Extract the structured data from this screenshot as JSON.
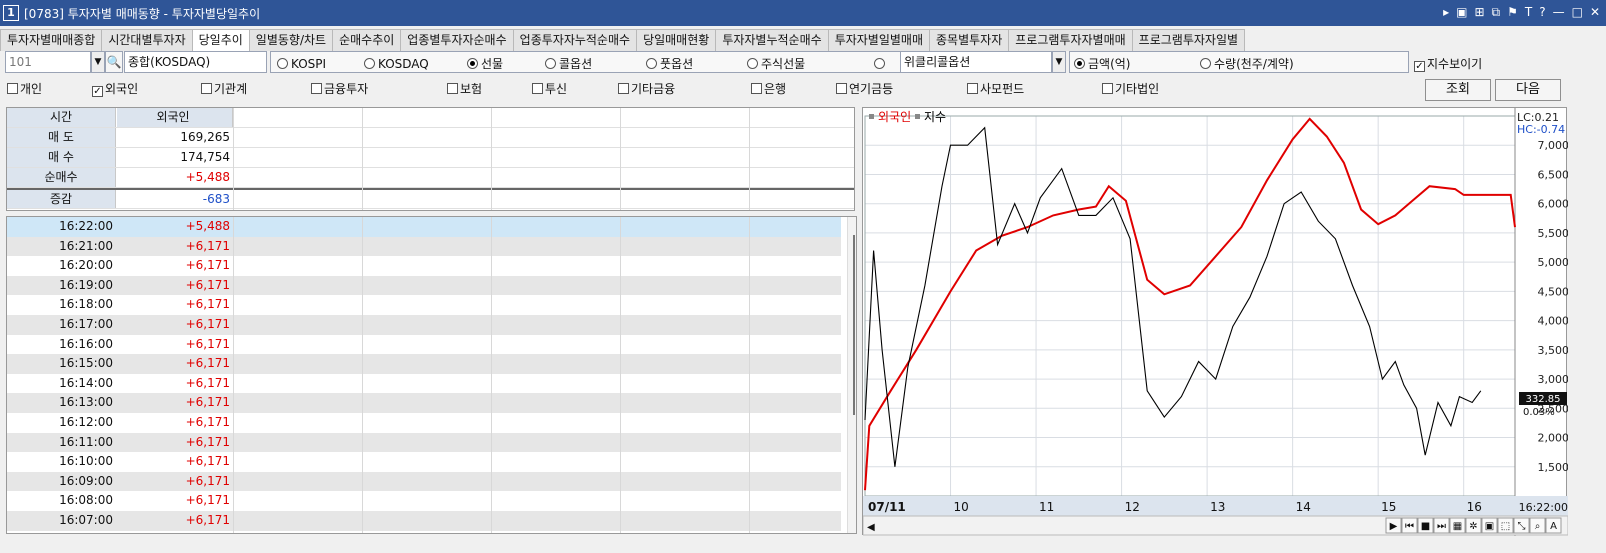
{
  "window": {
    "number": "1",
    "title": "[0783] 투자자별 매매동향 - 투자자별당일추이",
    "icons": [
      "menu-arrow-icon",
      "mdi-icon",
      "layout-icon",
      "restore-window-icon",
      "pin-icon",
      "font-icon",
      "help-icon",
      "minimize-icon",
      "maximize-icon",
      "close-icon"
    ]
  },
  "tabs": [
    "투자자별매매종합",
    "시간대별투자자",
    "당일추이",
    "일별동향/차트",
    "순매수추이",
    "업종별투자자순매수",
    "업종투자자누적순매수",
    "당일매매현황",
    "투자자별누적순매수",
    "투자자별일별매매",
    "종목별투자자",
    "프로그램투자자별매매",
    "프로그램투자자일별"
  ],
  "active_tab": "당일추이",
  "filters": {
    "code": "101",
    "market": "종합(KOSDAQ)",
    "market_radios": [
      "KOSPI",
      "KOSDAQ",
      "선물",
      "콜옵션",
      "풋옵션",
      "주식선물",
      ""
    ],
    "selected_market_radio": "선물",
    "product": "위클리콜옵션",
    "unit_radios": [
      "금액(억)",
      "수량(천주/계약)"
    ],
    "selected_unit": "금액(억)",
    "show_index_label": "지수보이기",
    "show_index": true
  },
  "investors": [
    {
      "label": "개인",
      "checked": false
    },
    {
      "label": "외국인",
      "checked": true
    },
    {
      "label": "기관계",
      "checked": false
    },
    {
      "label": "금융투자",
      "checked": false
    },
    {
      "label": "보험",
      "checked": false
    },
    {
      "label": "투신",
      "checked": false
    },
    {
      "label": "기타금융",
      "checked": false
    },
    {
      "label": "은행",
      "checked": false
    },
    {
      "label": "연기금등",
      "checked": false
    },
    {
      "label": "사모펀드",
      "checked": false
    },
    {
      "label": "기타법인",
      "checked": false
    }
  ],
  "buttons": {
    "query": "조회",
    "next": "다음"
  },
  "summary": {
    "header": {
      "time": "시간",
      "investor": "외국인"
    },
    "rows": [
      {
        "label": "매 도",
        "value": "169,265",
        "tone": ""
      },
      {
        "label": "매 수",
        "value": "174,754",
        "tone": ""
      },
      {
        "label": "순매수",
        "value": "+5,488",
        "tone": "pos"
      },
      {
        "label": "증감",
        "value": "-683",
        "tone": "neg"
      }
    ]
  },
  "timeseries": [
    {
      "time": "16:22:00",
      "value": "+5,488"
    },
    {
      "time": "16:21:00",
      "value": "+6,171"
    },
    {
      "time": "16:20:00",
      "value": "+6,171"
    },
    {
      "time": "16:19:00",
      "value": "+6,171"
    },
    {
      "time": "16:18:00",
      "value": "+6,171"
    },
    {
      "time": "16:17:00",
      "value": "+6,171"
    },
    {
      "time": "16:16:00",
      "value": "+6,171"
    },
    {
      "time": "16:15:00",
      "value": "+6,171"
    },
    {
      "time": "16:14:00",
      "value": "+6,171"
    },
    {
      "time": "16:13:00",
      "value": "+6,171"
    },
    {
      "time": "16:12:00",
      "value": "+6,171"
    },
    {
      "time": "16:11:00",
      "value": "+6,171"
    },
    {
      "time": "16:10:00",
      "value": "+6,171"
    },
    {
      "time": "16:09:00",
      "value": "+6,171"
    },
    {
      "time": "16:08:00",
      "value": "+6,171"
    },
    {
      "time": "16:07:00",
      "value": "+6,171"
    }
  ],
  "selected_row": 0,
  "chart": {
    "legend": [
      {
        "label": "외국인",
        "color": "#e00000"
      },
      {
        "label": "지수",
        "color": "#000000"
      }
    ],
    "lc_label": "LC:0.21",
    "hc_label": "HC:-0.74",
    "index_current": "332.85",
    "index_change": "0.03%",
    "time_label": "16:22:00"
  },
  "chart_data": {
    "type": "line",
    "x_ticks": [
      "07/11",
      "10",
      "11",
      "12",
      "13",
      "14",
      "15",
      "16"
    ],
    "y_ticks": [
      "1,500",
      "2,000",
      "2,500",
      "3,000",
      "3,500",
      "4,000",
      "4,500",
      "5,000",
      "5,500",
      "6,000",
      "6,500",
      "7,000"
    ],
    "ylim": [
      1000,
      7500
    ],
    "series": [
      {
        "name": "외국인",
        "color": "#e00000",
        "points": [
          [
            0,
            1100
          ],
          [
            0.05,
            2200
          ],
          [
            0.3,
            2800
          ],
          [
            0.6,
            3500
          ],
          [
            1.0,
            4500
          ],
          [
            1.3,
            5200
          ],
          [
            1.6,
            5450
          ],
          [
            1.9,
            5600
          ],
          [
            2.2,
            5800
          ],
          [
            2.5,
            5900
          ],
          [
            2.7,
            5950
          ],
          [
            2.85,
            6300
          ],
          [
            3.05,
            6050
          ],
          [
            3.3,
            4700
          ],
          [
            3.5,
            4450
          ],
          [
            3.8,
            4600
          ],
          [
            4.1,
            5100
          ],
          [
            4.4,
            5600
          ],
          [
            4.7,
            6400
          ],
          [
            5.0,
            7100
          ],
          [
            5.2,
            7450
          ],
          [
            5.4,
            7150
          ],
          [
            5.6,
            6700
          ],
          [
            5.8,
            5900
          ],
          [
            6.0,
            5650
          ],
          [
            6.2,
            5800
          ],
          [
            6.4,
            6050
          ],
          [
            6.6,
            6300
          ],
          [
            6.9,
            6250
          ],
          [
            7.0,
            6150
          ],
          [
            7.3,
            6150
          ],
          [
            7.55,
            6150
          ],
          [
            7.6,
            5600
          ]
        ]
      },
      {
        "name": "지수",
        "color": "#000000",
        "points": [
          [
            0,
            2300
          ],
          [
            0.1,
            5200
          ],
          [
            0.2,
            3500
          ],
          [
            0.35,
            1500
          ],
          [
            0.5,
            3200
          ],
          [
            0.7,
            4600
          ],
          [
            0.9,
            6300
          ],
          [
            1.0,
            7000
          ],
          [
            1.2,
            7000
          ],
          [
            1.4,
            7300
          ],
          [
            1.55,
            5300
          ],
          [
            1.75,
            6000
          ],
          [
            1.9,
            5500
          ],
          [
            2.05,
            6100
          ],
          [
            2.3,
            6600
          ],
          [
            2.5,
            5800
          ],
          [
            2.7,
            5800
          ],
          [
            2.9,
            6100
          ],
          [
            3.1,
            5400
          ],
          [
            3.3,
            2800
          ],
          [
            3.5,
            2350
          ],
          [
            3.7,
            2700
          ],
          [
            3.9,
            3300
          ],
          [
            4.1,
            3000
          ],
          [
            4.3,
            3900
          ],
          [
            4.5,
            4400
          ],
          [
            4.7,
            5100
          ],
          [
            4.9,
            6000
          ],
          [
            5.1,
            6200
          ],
          [
            5.3,
            5700
          ],
          [
            5.5,
            5400
          ],
          [
            5.7,
            4600
          ],
          [
            5.9,
            3900
          ],
          [
            6.05,
            3000
          ],
          [
            6.2,
            3300
          ],
          [
            6.3,
            2900
          ],
          [
            6.45,
            2500
          ],
          [
            6.55,
            1700
          ],
          [
            6.7,
            2600
          ],
          [
            6.85,
            2200
          ],
          [
            6.95,
            2700
          ],
          [
            7.1,
            2600
          ],
          [
            7.2,
            2800
          ]
        ]
      }
    ]
  }
}
